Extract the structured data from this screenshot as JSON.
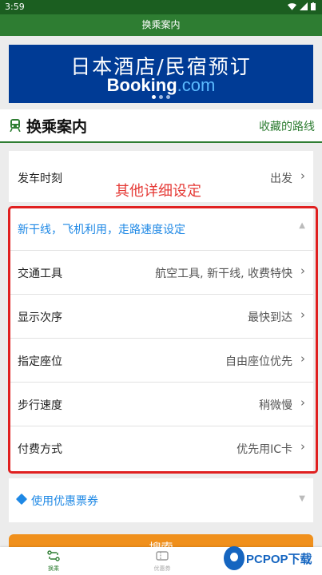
{
  "status": {
    "time": "3:59"
  },
  "app": {
    "title": "换乘案内"
  },
  "ad": {
    "line1": "日本酒店/民宿预订",
    "line2_brand": "Booking",
    "line2_dot": ".com"
  },
  "section": {
    "title": "换乘案内",
    "favorites_link": "收藏的路线"
  },
  "departure": {
    "label": "发车时刻",
    "value": "出发"
  },
  "annotation": "其他详细设定",
  "details": {
    "header": "新干线，飞机利用，走路速度设定",
    "rows": [
      {
        "label": "交通工具",
        "value": "航空工具, 新干线, 收费特快"
      },
      {
        "label": "显示次序",
        "value": "最快到达"
      },
      {
        "label": "指定座位",
        "value": "自由座位优先"
      },
      {
        "label": "步行速度",
        "value": "稍微慢"
      },
      {
        "label": "付费方式",
        "value": "优先用IC卡"
      }
    ]
  },
  "coupon": {
    "label": "使用优惠票券"
  },
  "search": {
    "label": "搜索"
  },
  "nav": [
    {
      "label": "换乘"
    },
    {
      "label": "优惠券"
    }
  ],
  "watermark": {
    "brand": "PCPOP下载"
  },
  "colors": {
    "primary": "#2e7d32",
    "accent_blue": "#1e88e5",
    "search_orange": "#f0901c",
    "annotation_red": "#e02020"
  }
}
